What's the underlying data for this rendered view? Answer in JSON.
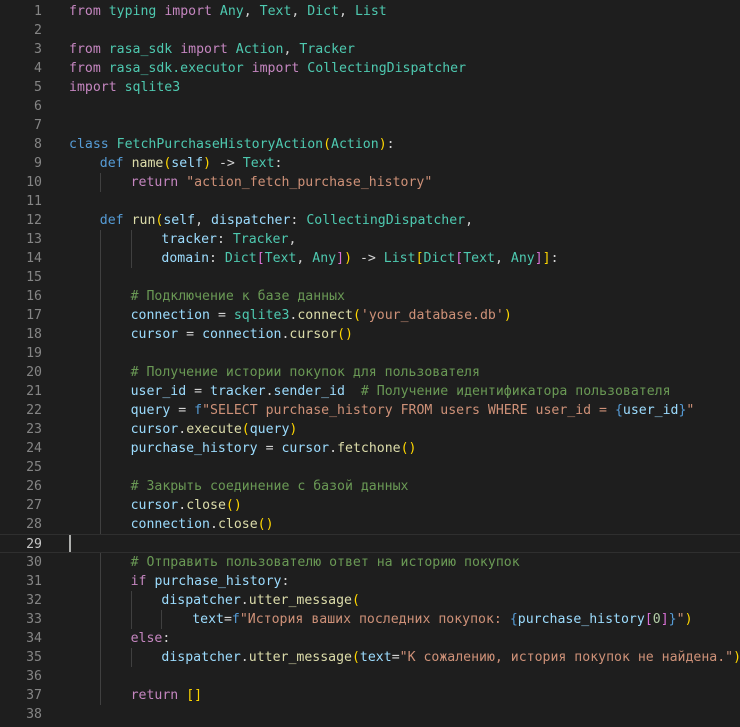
{
  "editor": {
    "language": "python",
    "current_line": 29,
    "lines": [
      {
        "n": "1",
        "indent": 0,
        "tokens": [
          [
            "kw",
            "from"
          ],
          [
            "op",
            " "
          ],
          [
            "cls",
            "typing"
          ],
          [
            "op",
            " "
          ],
          [
            "kw",
            "import"
          ],
          [
            "op",
            " "
          ],
          [
            "cls",
            "Any"
          ],
          [
            "op",
            ", "
          ],
          [
            "cls",
            "Text"
          ],
          [
            "op",
            ", "
          ],
          [
            "cls",
            "Dict"
          ],
          [
            "op",
            ", "
          ],
          [
            "cls",
            "List"
          ]
        ]
      },
      {
        "n": "2",
        "indent": 0,
        "tokens": []
      },
      {
        "n": "3",
        "indent": 0,
        "tokens": [
          [
            "kw",
            "from"
          ],
          [
            "op",
            " "
          ],
          [
            "cls",
            "rasa_sdk"
          ],
          [
            "op",
            " "
          ],
          [
            "kw",
            "import"
          ],
          [
            "op",
            " "
          ],
          [
            "cls",
            "Action"
          ],
          [
            "op",
            ", "
          ],
          [
            "cls",
            "Tracker"
          ]
        ]
      },
      {
        "n": "4",
        "indent": 0,
        "tokens": [
          [
            "kw",
            "from"
          ],
          [
            "op",
            " "
          ],
          [
            "cls",
            "rasa_sdk.executor"
          ],
          [
            "op",
            " "
          ],
          [
            "kw",
            "import"
          ],
          [
            "op",
            " "
          ],
          [
            "cls",
            "CollectingDispatcher"
          ]
        ]
      },
      {
        "n": "5",
        "indent": 0,
        "tokens": [
          [
            "kw",
            "import"
          ],
          [
            "op",
            " "
          ],
          [
            "cls",
            "sqlite3"
          ]
        ]
      },
      {
        "n": "6",
        "indent": 0,
        "tokens": []
      },
      {
        "n": "7",
        "indent": 0,
        "tokens": []
      },
      {
        "n": "8",
        "indent": 0,
        "tokens": [
          [
            "st",
            "class"
          ],
          [
            "op",
            " "
          ],
          [
            "cls",
            "FetchPurchaseHistoryAction"
          ],
          [
            "b1",
            "("
          ],
          [
            "cls",
            "Action"
          ],
          [
            "b1",
            ")"
          ],
          [
            "op",
            ":"
          ]
        ]
      },
      {
        "n": "9",
        "indent": 1,
        "tokens": [
          [
            "st",
            "def"
          ],
          [
            "op",
            " "
          ],
          [
            "fn",
            "name"
          ],
          [
            "b1",
            "("
          ],
          [
            "var",
            "self"
          ],
          [
            "b1",
            ")"
          ],
          [
            "op",
            " -> "
          ],
          [
            "cls",
            "Text"
          ],
          [
            "op",
            ":"
          ]
        ]
      },
      {
        "n": "10",
        "indent": 2,
        "tokens": [
          [
            "kw",
            "return"
          ],
          [
            "op",
            " "
          ],
          [
            "str",
            "\"action_fetch_purchase_history\""
          ]
        ]
      },
      {
        "n": "11",
        "indent": 1,
        "tokens": []
      },
      {
        "n": "12",
        "indent": 1,
        "tokens": [
          [
            "st",
            "def"
          ],
          [
            "op",
            " "
          ],
          [
            "fn",
            "run"
          ],
          [
            "b1",
            "("
          ],
          [
            "var",
            "self"
          ],
          [
            "op",
            ", "
          ],
          [
            "var",
            "dispatcher"
          ],
          [
            "op",
            ": "
          ],
          [
            "cls",
            "CollectingDispatcher"
          ],
          [
            "op",
            ","
          ]
        ]
      },
      {
        "n": "13",
        "indent": 3,
        "tokens": [
          [
            "var",
            "tracker"
          ],
          [
            "op",
            ": "
          ],
          [
            "cls",
            "Tracker"
          ],
          [
            "op",
            ","
          ]
        ]
      },
      {
        "n": "14",
        "indent": 3,
        "tokens": [
          [
            "var",
            "domain"
          ],
          [
            "op",
            ": "
          ],
          [
            "cls",
            "Dict"
          ],
          [
            "b2",
            "["
          ],
          [
            "cls",
            "Text"
          ],
          [
            "op",
            ", "
          ],
          [
            "cls",
            "Any"
          ],
          [
            "b2",
            "]"
          ],
          [
            "b1",
            ")"
          ],
          [
            "op",
            " -> "
          ],
          [
            "cls",
            "List"
          ],
          [
            "b1",
            "["
          ],
          [
            "cls",
            "Dict"
          ],
          [
            "b2",
            "["
          ],
          [
            "cls",
            "Text"
          ],
          [
            "op",
            ", "
          ],
          [
            "cls",
            "Any"
          ],
          [
            "b2",
            "]"
          ],
          [
            "b1",
            "]"
          ],
          [
            "op",
            ":"
          ]
        ]
      },
      {
        "n": "15",
        "indent": 2,
        "tokens": []
      },
      {
        "n": "16",
        "indent": 2,
        "tokens": [
          [
            "cmt",
            "# Подключение к базе данных"
          ]
        ]
      },
      {
        "n": "17",
        "indent": 2,
        "tokens": [
          [
            "var",
            "connection"
          ],
          [
            "op",
            " = "
          ],
          [
            "cls",
            "sqlite3"
          ],
          [
            "op",
            "."
          ],
          [
            "fn",
            "connect"
          ],
          [
            "b1",
            "("
          ],
          [
            "str",
            "'your_database.db'"
          ],
          [
            "b1",
            ")"
          ]
        ]
      },
      {
        "n": "18",
        "indent": 2,
        "tokens": [
          [
            "var",
            "cursor"
          ],
          [
            "op",
            " = "
          ],
          [
            "var",
            "connection"
          ],
          [
            "op",
            "."
          ],
          [
            "fn",
            "cursor"
          ],
          [
            "b1",
            "()"
          ]
        ]
      },
      {
        "n": "19",
        "indent": 2,
        "tokens": []
      },
      {
        "n": "20",
        "indent": 2,
        "tokens": [
          [
            "cmt",
            "# Получение истории покупок для пользователя"
          ]
        ]
      },
      {
        "n": "21",
        "indent": 2,
        "tokens": [
          [
            "var",
            "user_id"
          ],
          [
            "op",
            " = "
          ],
          [
            "var",
            "tracker"
          ],
          [
            "op",
            "."
          ],
          [
            "var",
            "sender_id"
          ],
          [
            "op",
            "  "
          ],
          [
            "cmt",
            "# Получение идентификатора пользователя"
          ]
        ]
      },
      {
        "n": "22",
        "indent": 2,
        "tokens": [
          [
            "var",
            "query"
          ],
          [
            "op",
            " = "
          ],
          [
            "st",
            "f"
          ],
          [
            "str",
            "\"SELECT purchase_history FROM users WHERE user_id = "
          ],
          [
            "st",
            "{"
          ],
          [
            "var",
            "user_id"
          ],
          [
            "st",
            "}"
          ],
          [
            "str",
            "\""
          ]
        ]
      },
      {
        "n": "23",
        "indent": 2,
        "tokens": [
          [
            "var",
            "cursor"
          ],
          [
            "op",
            "."
          ],
          [
            "fn",
            "execute"
          ],
          [
            "b1",
            "("
          ],
          [
            "var",
            "query"
          ],
          [
            "b1",
            ")"
          ]
        ]
      },
      {
        "n": "24",
        "indent": 2,
        "tokens": [
          [
            "var",
            "purchase_history"
          ],
          [
            "op",
            " = "
          ],
          [
            "var",
            "cursor"
          ],
          [
            "op",
            "."
          ],
          [
            "fn",
            "fetchone"
          ],
          [
            "b1",
            "()"
          ]
        ]
      },
      {
        "n": "25",
        "indent": 2,
        "tokens": []
      },
      {
        "n": "26",
        "indent": 2,
        "tokens": [
          [
            "cmt",
            "# Закрыть соединение с базой данных"
          ]
        ]
      },
      {
        "n": "27",
        "indent": 2,
        "tokens": [
          [
            "var",
            "cursor"
          ],
          [
            "op",
            "."
          ],
          [
            "fn",
            "close"
          ],
          [
            "b1",
            "()"
          ]
        ]
      },
      {
        "n": "28",
        "indent": 2,
        "tokens": [
          [
            "var",
            "connection"
          ],
          [
            "op",
            "."
          ],
          [
            "fn",
            "close"
          ],
          [
            "b1",
            "()"
          ]
        ]
      },
      {
        "n": "29",
        "indent": 0,
        "tokens": []
      },
      {
        "n": "30",
        "indent": 2,
        "tokens": [
          [
            "cmt",
            "# Отправить пользователю ответ на историю покупок"
          ]
        ]
      },
      {
        "n": "31",
        "indent": 2,
        "tokens": [
          [
            "kw",
            "if"
          ],
          [
            "op",
            " "
          ],
          [
            "var",
            "purchase_history"
          ],
          [
            "op",
            ":"
          ]
        ]
      },
      {
        "n": "32",
        "indent": 3,
        "tokens": [
          [
            "var",
            "dispatcher"
          ],
          [
            "op",
            "."
          ],
          [
            "fn",
            "utter_message"
          ],
          [
            "b1",
            "("
          ]
        ]
      },
      {
        "n": "33",
        "indent": 4,
        "tokens": [
          [
            "var",
            "text"
          ],
          [
            "op",
            "="
          ],
          [
            "st",
            "f"
          ],
          [
            "str",
            "\"История ваших последних покупок: "
          ],
          [
            "st",
            "{"
          ],
          [
            "var",
            "purchase_history"
          ],
          [
            "b2",
            "["
          ],
          [
            "num-lit",
            "0"
          ],
          [
            "b2",
            "]"
          ],
          [
            "st",
            "}"
          ],
          [
            "str",
            "\""
          ],
          [
            "b1",
            ")"
          ]
        ]
      },
      {
        "n": "34",
        "indent": 2,
        "tokens": [
          [
            "kw",
            "else"
          ],
          [
            "op",
            ":"
          ]
        ]
      },
      {
        "n": "35",
        "indent": 3,
        "tokens": [
          [
            "var",
            "dispatcher"
          ],
          [
            "op",
            "."
          ],
          [
            "fn",
            "utter_message"
          ],
          [
            "b1",
            "("
          ],
          [
            "var",
            "text"
          ],
          [
            "op",
            "="
          ],
          [
            "str",
            "\"К сожалению, история покупок не найдена.\""
          ],
          [
            "b1",
            ")"
          ]
        ]
      },
      {
        "n": "36",
        "indent": 2,
        "tokens": []
      },
      {
        "n": "37",
        "indent": 2,
        "tokens": [
          [
            "kw",
            "return"
          ],
          [
            "op",
            " "
          ],
          [
            "b1",
            "[]"
          ]
        ]
      },
      {
        "n": "38",
        "indent": 0,
        "tokens": []
      }
    ]
  }
}
